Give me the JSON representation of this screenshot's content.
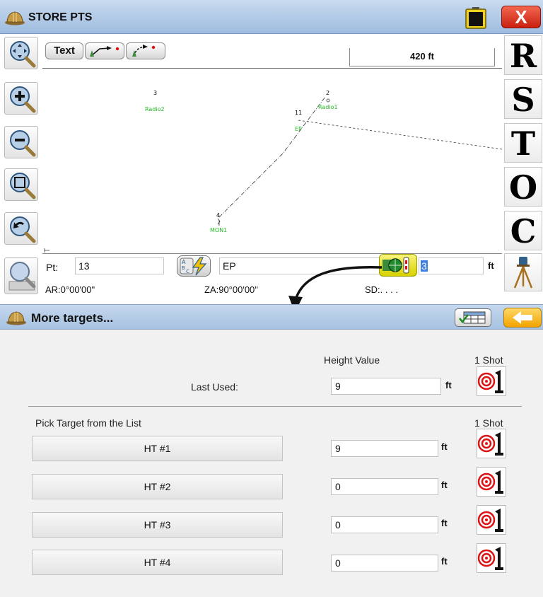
{
  "window": {
    "title": "STORE PTS",
    "close_label": "X"
  },
  "toolbar": {
    "text_label": "Text",
    "scale": "420 ft"
  },
  "right_toolbar": [
    "R",
    "S",
    "T",
    "O",
    "C"
  ],
  "map": {
    "points": [
      {
        "number": "3",
        "description": "Radio2"
      },
      {
        "number": "2",
        "description": "Radio1"
      },
      {
        "number": "11",
        "description": "EP"
      },
      {
        "number": "4",
        "description": "MON1"
      }
    ]
  },
  "point_entry": {
    "pt_label": "Pt:",
    "pt_value": "13",
    "description_value": "EP",
    "height_value": "3",
    "unit": "ft",
    "ar_readout": "AR:0°00'00\"",
    "za_readout": "ZA:90°00'00\"",
    "sd_readout": "SD:. . . ."
  },
  "targets_panel": {
    "title": "More targets...",
    "height_value_header": "Height Value",
    "one_shot_label": "1 Shot",
    "last_used_label": "Last Used:",
    "last_used_value": "9",
    "unit": "ft",
    "pick_label": "Pick Target from the List",
    "targets": [
      {
        "label": "HT #1",
        "value": "9"
      },
      {
        "label": "HT #2",
        "value": "0"
      },
      {
        "label": "HT #3",
        "value": "0"
      },
      {
        "label": "HT #4",
        "value": "0"
      }
    ]
  }
}
